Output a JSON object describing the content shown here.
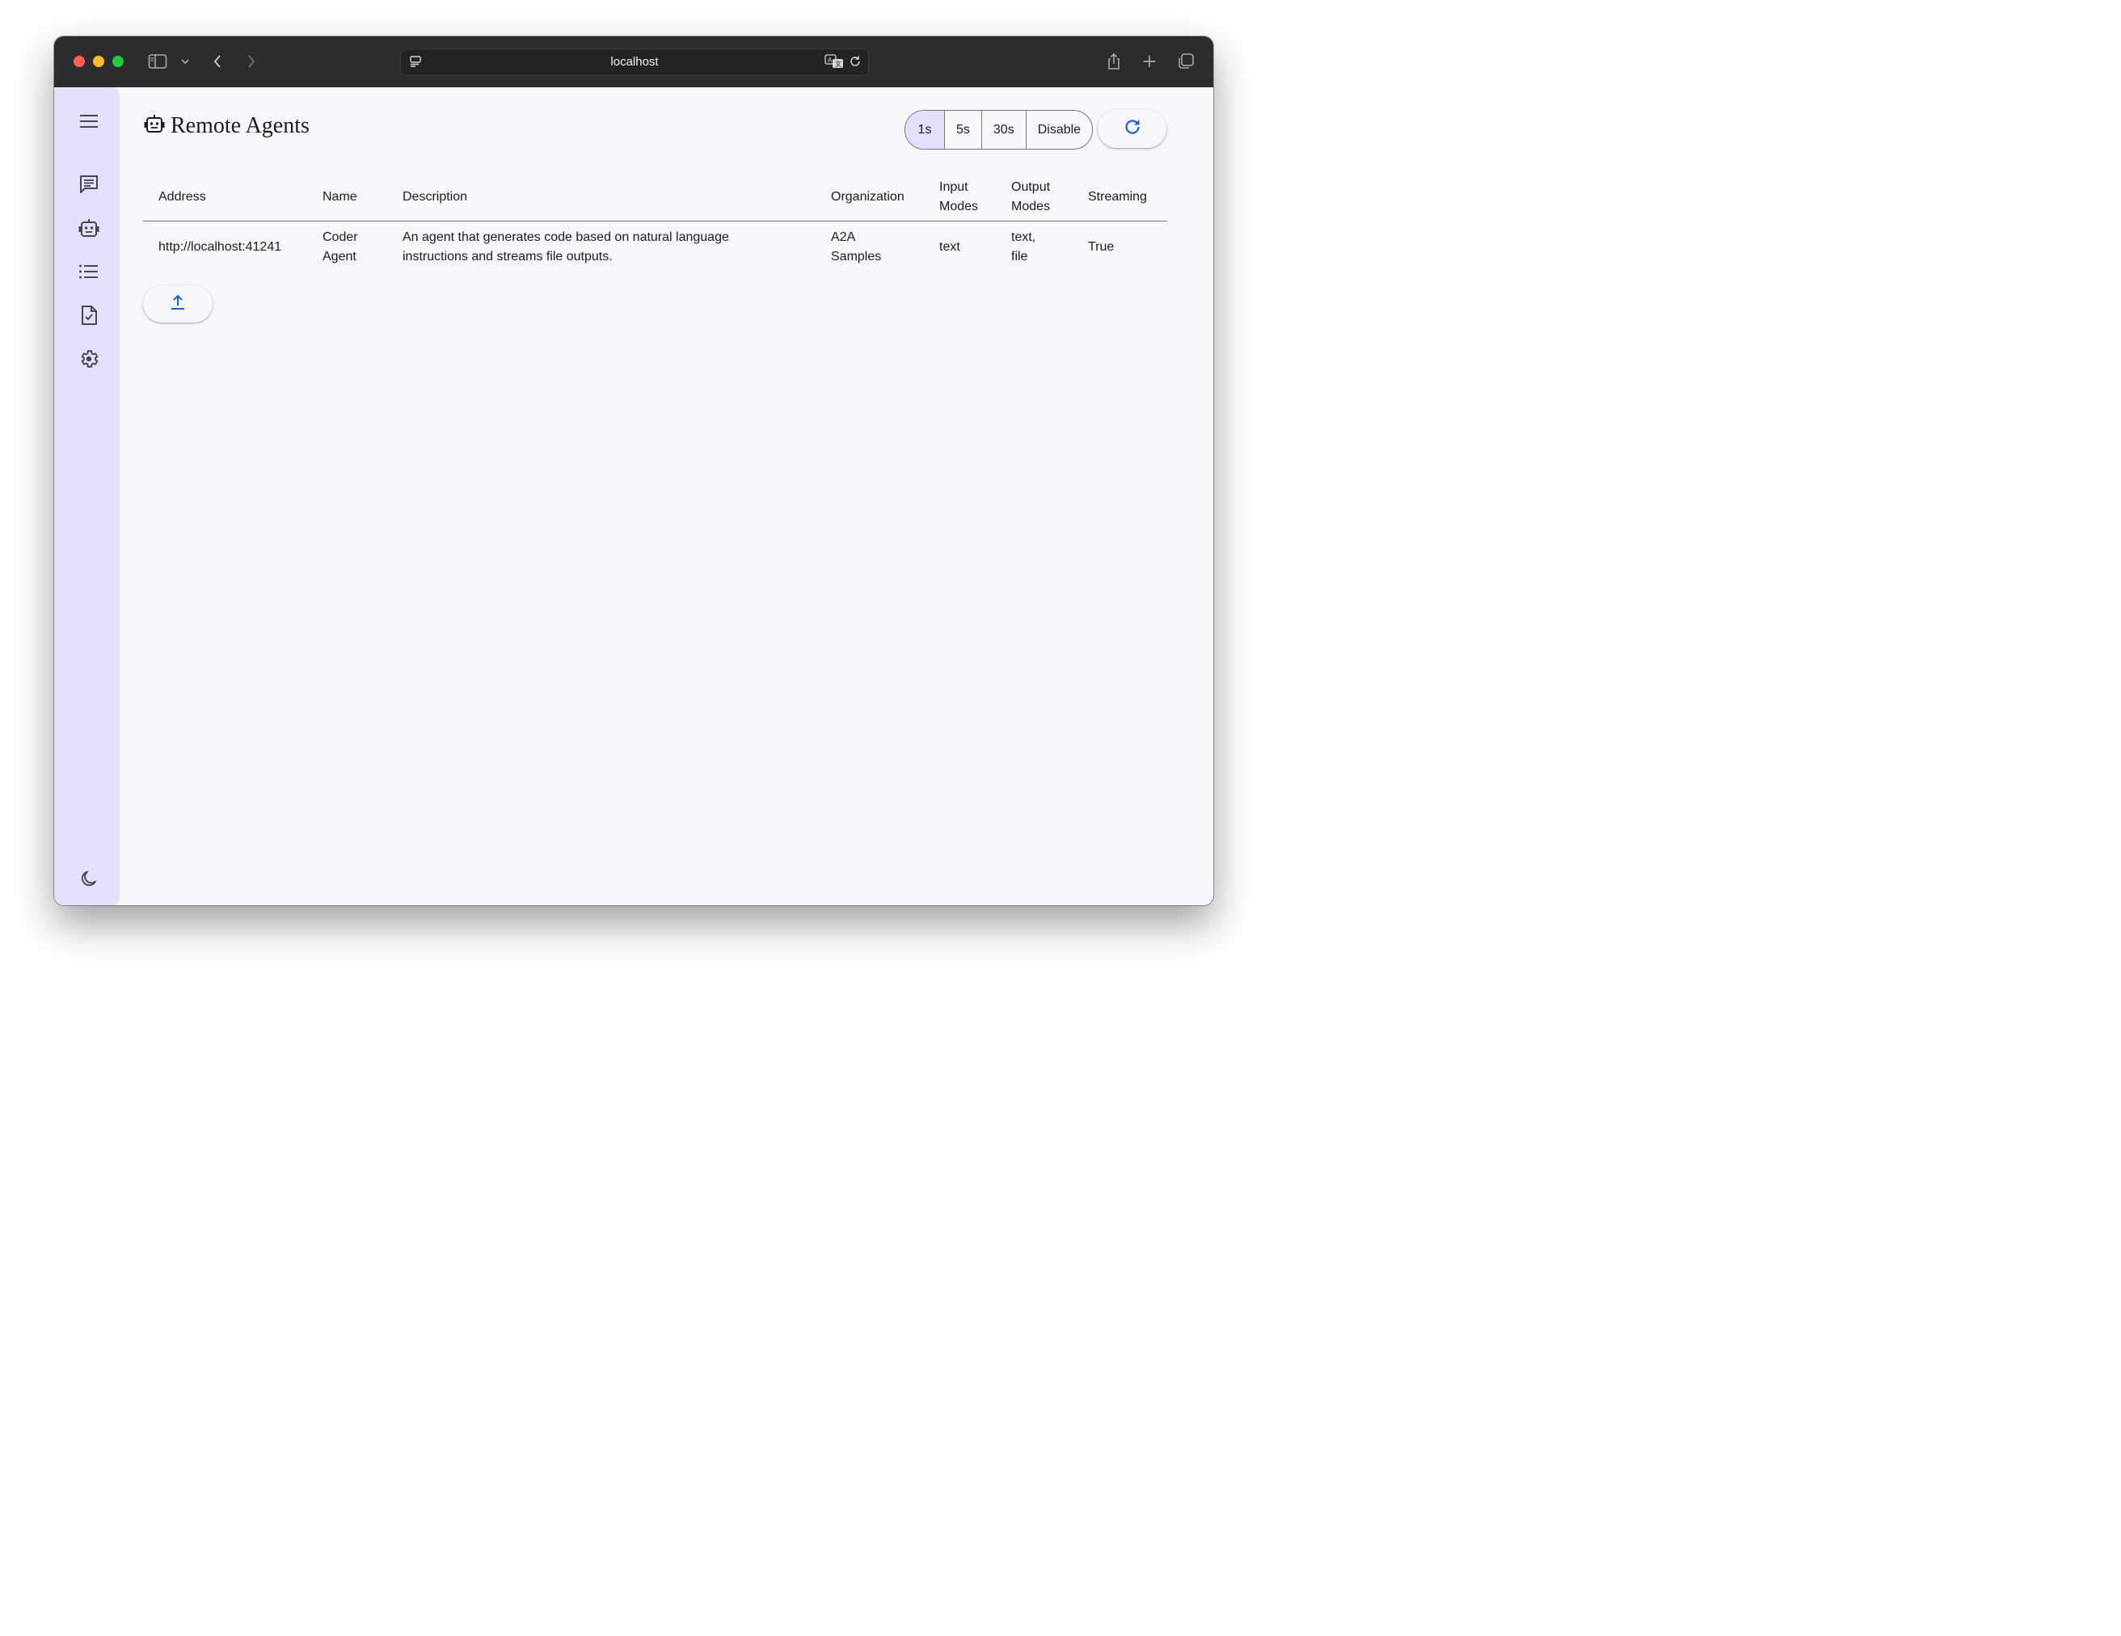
{
  "browser": {
    "url": "localhost"
  },
  "page": {
    "title": "Remote Agents"
  },
  "refresh_intervals": {
    "options": [
      "1s",
      "5s",
      "30s",
      "Disable"
    ],
    "selected": "1s"
  },
  "table": {
    "headers": {
      "address": "Address",
      "name": "Name",
      "description": "Description",
      "organization": "Organization",
      "input_modes_line1": "Input",
      "input_modes_line2": "Modes",
      "output_modes_line1": "Output",
      "output_modes_line2": "Modes",
      "streaming": "Streaming"
    },
    "rows": [
      {
        "address": "http://localhost:41241",
        "name_line1": "Coder",
        "name_line2": "Agent",
        "description_line1": "An agent that generates code based on natural language",
        "description_line2": "instructions and streams file outputs.",
        "organization_line1": "A2A",
        "organization_line2": "Samples",
        "input_modes": "text",
        "output_modes_line1": "text,",
        "output_modes_line2": "file",
        "streaming": "True"
      }
    ]
  },
  "colors": {
    "sidebar_bg": "#e1e2fa",
    "page_bg": "#f8f7fc",
    "accent": "#1a63c7",
    "selected_segment": "#dfe1f8"
  },
  "icons": {
    "sidebar": [
      "menu-icon",
      "chat-icon",
      "robot-icon",
      "list-icon",
      "task-file-icon",
      "settings-icon",
      "dark-mode-icon"
    ],
    "actions": [
      "refresh-icon",
      "upload-icon"
    ]
  }
}
